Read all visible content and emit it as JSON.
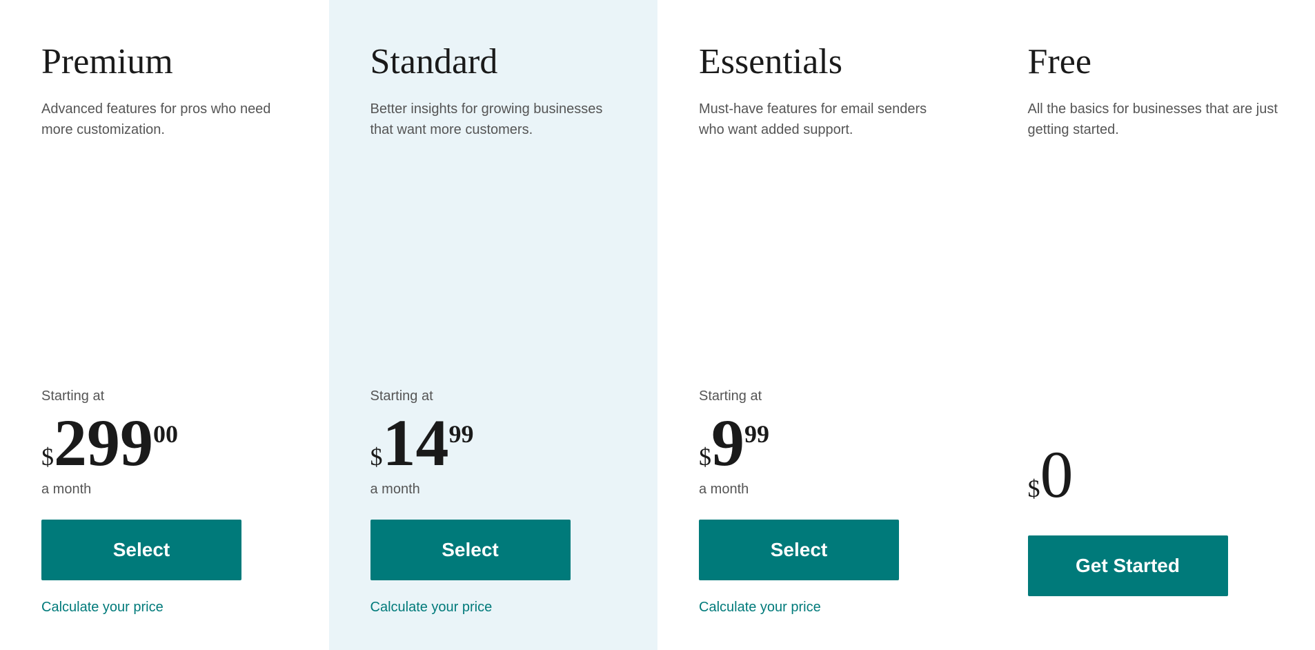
{
  "plans": [
    {
      "id": "premium",
      "name": "Premium",
      "description": "Advanced features for pros who need more customization.",
      "highlighted": false,
      "starting_at_label": "Starting at",
      "currency": "$",
      "price_main": "299",
      "price_cents": "00",
      "price_period": "a month",
      "button_label": "Select",
      "calculate_label": "Calculate your price",
      "is_free": false
    },
    {
      "id": "standard",
      "name": "Standard",
      "description": "Better insights for growing businesses that want more customers.",
      "highlighted": true,
      "starting_at_label": "Starting at",
      "currency": "$",
      "price_main": "14",
      "price_cents": "99",
      "price_period": "a month",
      "button_label": "Select",
      "calculate_label": "Calculate your price",
      "is_free": false
    },
    {
      "id": "essentials",
      "name": "Essentials",
      "description": "Must-have features for email senders who want added support.",
      "highlighted": false,
      "starting_at_label": "Starting at",
      "currency": "$",
      "price_main": "9",
      "price_cents": "99",
      "price_period": "a month",
      "button_label": "Select",
      "calculate_label": "Calculate your price",
      "is_free": false
    },
    {
      "id": "free",
      "name": "Free",
      "description": "All the basics for businesses that are just getting started.",
      "highlighted": false,
      "starting_at_label": "",
      "currency": "$",
      "price_main": "0",
      "price_cents": "",
      "price_period": "",
      "button_label": "Get Started",
      "calculate_label": "",
      "is_free": true
    }
  ]
}
